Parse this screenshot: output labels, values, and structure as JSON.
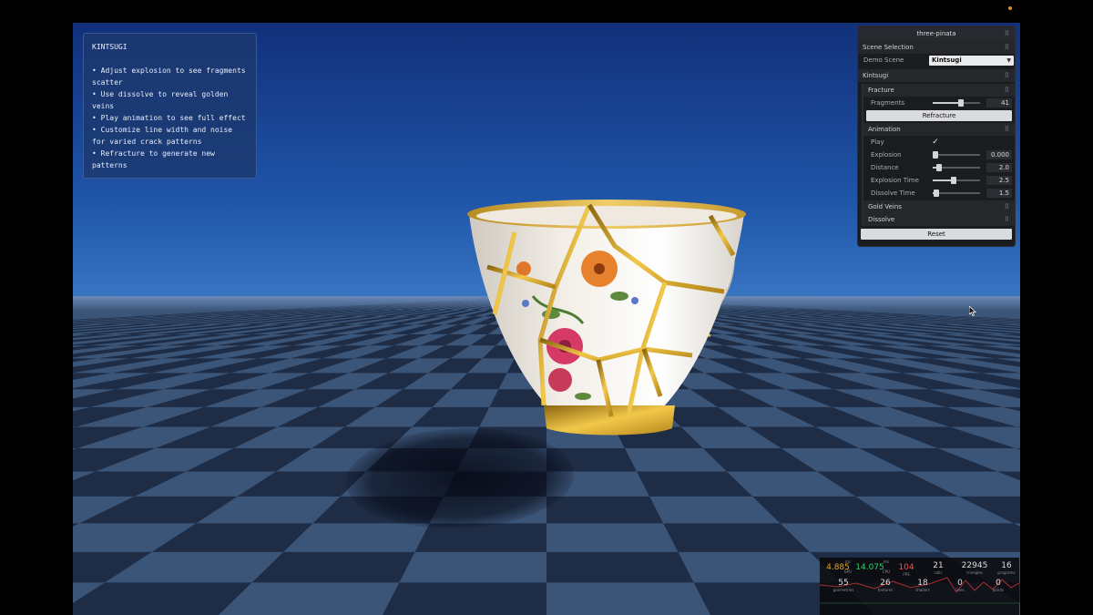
{
  "info_panel": {
    "title": "KINTSUGI",
    "lines": [
      "• Adjust explosion to see fragments scatter",
      "• Use dissolve to reveal golden veins",
      "• Play animation to see full effect",
      "• Customize line width and noise for varied crack patterns",
      "• Refracture to generate new patterns"
    ]
  },
  "gui": {
    "title": "three-pinata",
    "scene_selection": {
      "label": "Scene Selection",
      "demo_scene_label": "Demo Scene",
      "demo_scene_value": "Kintsugi"
    },
    "kintsugi_label": "Kintsugi",
    "fracture": {
      "label": "Fracture",
      "fragments_label": "Fragments",
      "fragments_value": "41",
      "fragments_level": 0.6,
      "refracture_label": "Refracture"
    },
    "animation": {
      "label": "Animation",
      "play_label": "Play",
      "play_checked": true,
      "explosion_label": "Explosion",
      "explosion_value": "0.000",
      "explosion_level": 0.0,
      "distance_label": "Distance",
      "distance_value": "2.0",
      "distance_level": 0.14,
      "explosion_time_label": "Explosion Time",
      "explosion_time_value": "2.5",
      "explosion_time_level": 0.45,
      "dissolve_time_label": "Dissolve Time",
      "dissolve_time_value": "1.5",
      "dissolve_time_level": 0.08
    },
    "gold_veins_label": "Gold Veins",
    "dissolve_label": "Dissolve",
    "reset_label": "Reset"
  },
  "stats": {
    "gpu_value": "4.885",
    "gpu_unit": "ms",
    "gpu_label": "GPU",
    "cpu_value": "14.075",
    "cpu_unit": "ms",
    "cpu_label": "CPU",
    "fps_value": "104",
    "fps_label": "FPS",
    "calls_value": "21",
    "calls_label": "calls",
    "triangles_value": "22945",
    "triangles_label": "triangles",
    "programs_value": "16",
    "programs_label": "programs",
    "geometries_value": "55",
    "geometries_label": "geometries",
    "textures_value": "26",
    "textures_label": "textures",
    "shaders_value": "18",
    "shaders_label": "shaders",
    "lines_value": "0",
    "lines_label": "lines",
    "points_value": "0",
    "points_label": "points",
    "colors": {
      "gpu": "#e0a030",
      "cpu": "#33d26a",
      "fps": "#ff4d4d"
    }
  },
  "icons": {
    "folder_toggle": "collapse-dots-icon",
    "cursor": "mouse-cursor-icon",
    "checkbox": "check-icon"
  }
}
